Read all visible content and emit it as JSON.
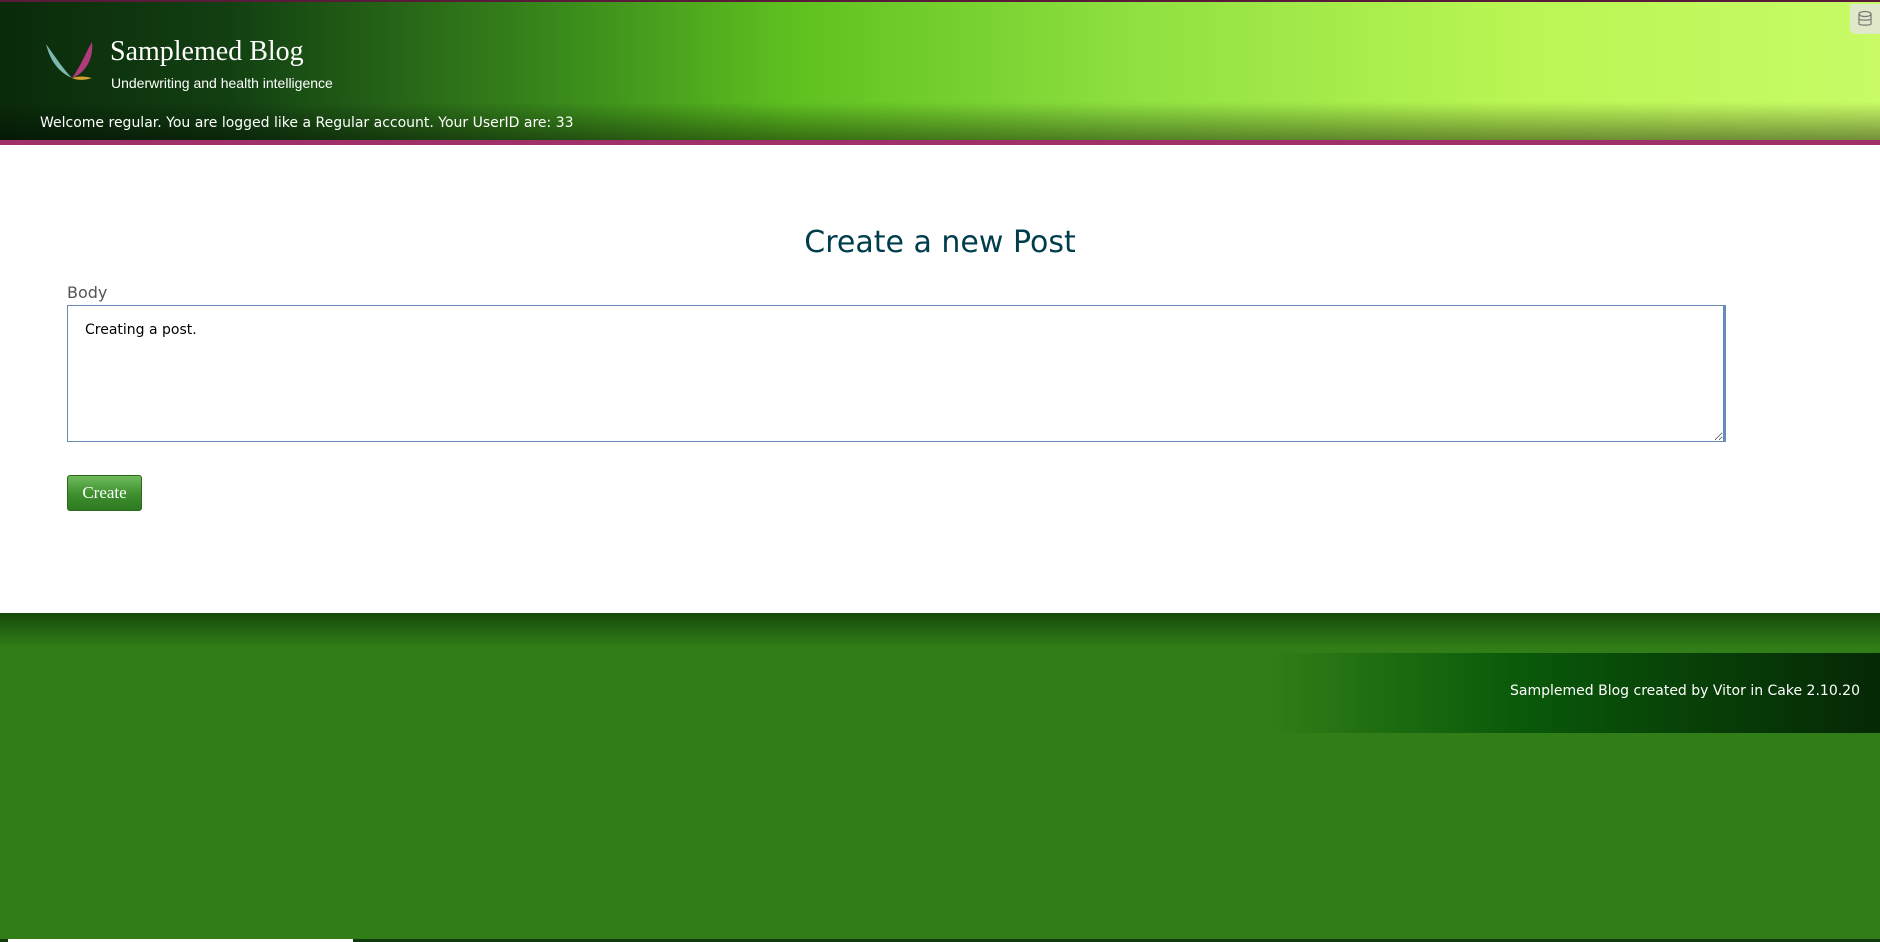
{
  "header": {
    "site_title": "Samplemed Blog",
    "site_subtitle": "Underwriting and health intelligence",
    "welcome_text": "Welcome regular. You are logged like a Regular account. Your UserID are: 33",
    "corner_icon": "database-icon",
    "logo": "bird-logo"
  },
  "main": {
    "page_title": "Create a new Post",
    "body_label": "Body",
    "body_value": "Creating a post.",
    "create_button_label": "Create"
  },
  "footer": {
    "credit_text": "Samplemed Blog created by Vitor in Cake 2.10.20"
  },
  "colors": {
    "header_gradient_start": "#0a2a0a",
    "header_gradient_end": "#c8fb66",
    "header_border": "#a0306a",
    "title_color": "#003d4c",
    "footer_background": "#317d17",
    "button_green": "#3d8f2e"
  }
}
